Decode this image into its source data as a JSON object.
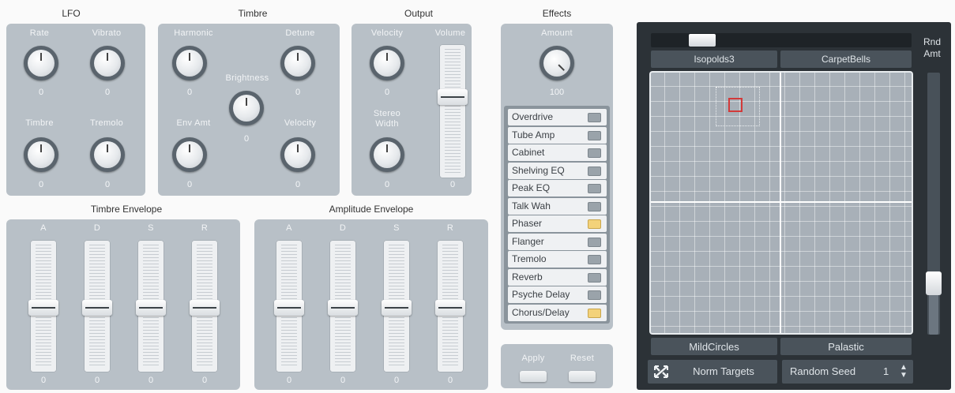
{
  "lfo": {
    "title": "LFO",
    "rate_label": "Rate",
    "rate_value": "0",
    "vibrato_label": "Vibrato",
    "vibrato_value": "0",
    "timbre_label": "Timbre",
    "timbre_value": "0",
    "tremolo_label": "Tremolo",
    "tremolo_value": "0"
  },
  "timbre": {
    "title": "Timbre",
    "harmonic_label": "Harmonic",
    "harmonic_value": "0",
    "detune_label": "Detune",
    "detune_value": "0",
    "brightness_label": "Brightness",
    "brightness_value": "0",
    "env_amt_label": "Env Amt",
    "env_amt_value": "0",
    "velocity_label": "Velocity",
    "velocity_value": "0"
  },
  "output": {
    "title": "Output",
    "velocity_label": "Velocity",
    "velocity_value": "0",
    "stereo_label": "Stereo",
    "stereo_label2": "Width",
    "stereo_value": "0",
    "volume_label": "Volume",
    "volume_value": "0",
    "volume_level": 0.62
  },
  "effects": {
    "title": "Effects",
    "amount_label": "Amount",
    "amount_value": "100",
    "items": [
      {
        "name": "Overdrive",
        "on": false
      },
      {
        "name": "Tube Amp",
        "on": false
      },
      {
        "name": "Cabinet",
        "on": false
      },
      {
        "name": "Shelving EQ",
        "on": false
      },
      {
        "name": "Peak EQ",
        "on": false
      },
      {
        "name": "Talk Wah",
        "on": false
      },
      {
        "name": "Phaser",
        "on": true
      },
      {
        "name": "Flanger",
        "on": false
      },
      {
        "name": "Tremolo",
        "on": false
      },
      {
        "name": "Reverb",
        "on": false
      },
      {
        "name": "Psyche Delay",
        "on": false
      },
      {
        "name": "Chorus/Delay",
        "on": true
      }
    ],
    "apply_label": "Apply",
    "reset_label": "Reset"
  },
  "timbre_env": {
    "title": "Timbre Envelope",
    "a_label": "A",
    "a_value": "0",
    "d_label": "D",
    "d_value": "0",
    "s_label": "S",
    "s_value": "0",
    "r_label": "R",
    "r_value": "0"
  },
  "amp_env": {
    "title": "Amplitude Envelope",
    "a_label": "A",
    "a_value": "0",
    "d_label": "D",
    "d_value": "0",
    "s_label": "S",
    "s_value": "0",
    "r_label": "R",
    "r_value": "0"
  },
  "pad": {
    "top_left": "Isopolds3",
    "top_right": "CarpetBells",
    "bottom_left": "MildCircles",
    "bottom_right": "Palastic",
    "rnd_label": "Rnd",
    "rnd_label2": "Amt",
    "norm_targets_label": "Norm Targets",
    "random_seed_label": "Random Seed",
    "random_seed_value": "1"
  }
}
